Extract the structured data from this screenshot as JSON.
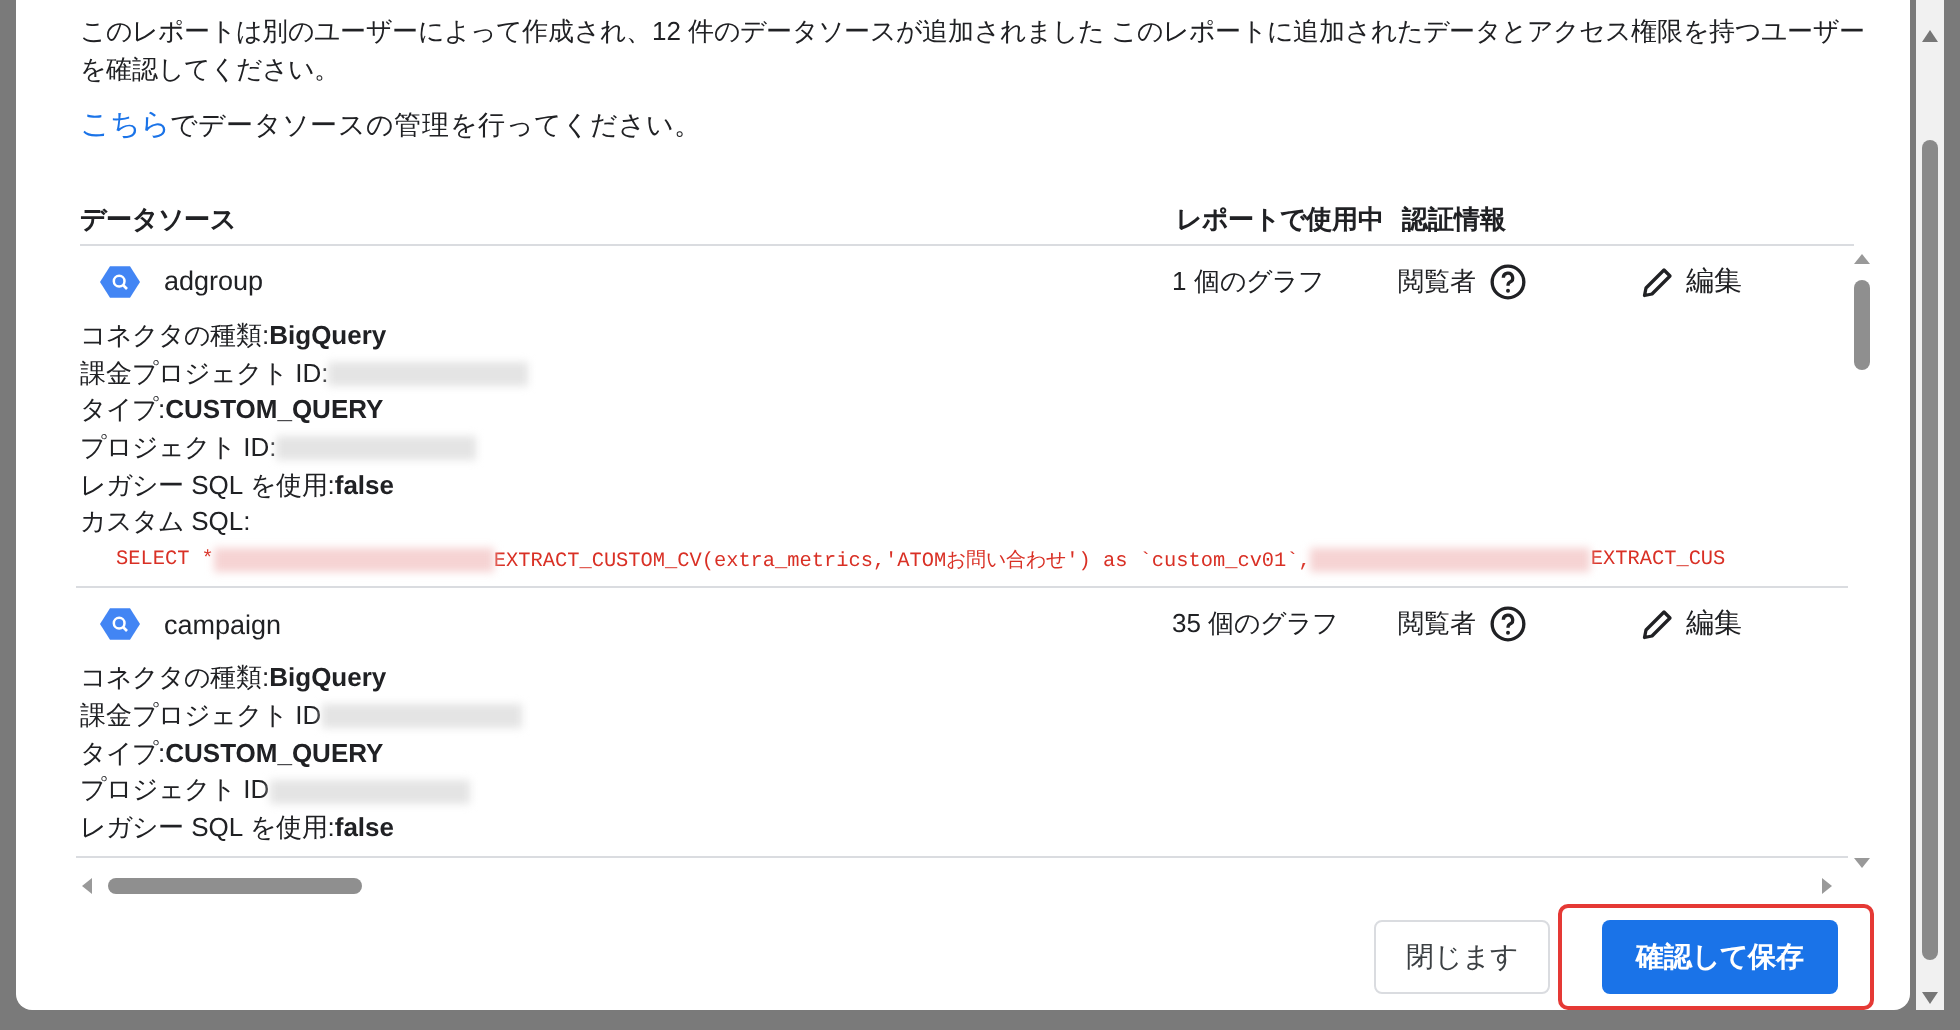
{
  "intro": "このレポートは別のユーザーによって作成され、12 件のデータソースが追加されました このレポートに追加されたデータとアクセス権限を持つユーザーを確認してください。",
  "manage": {
    "link": "こちら",
    "text": "でデータソースの管理を行ってください。"
  },
  "columns": [
    "データソース",
    "レポートで使用中",
    "認証情報"
  ],
  "rows": [
    {
      "name": "adgroup",
      "usage": "1 個のグラフ",
      "role": "閲覧者",
      "edit": "編集",
      "details": [
        {
          "label": "コネクタの種類: ",
          "value": "BigQuery"
        },
        {
          "label": "課金プロジェクト ID:",
          "redacted": true
        },
        {
          "label": "タイプ: ",
          "value": "CUSTOM_QUERY"
        },
        {
          "label": "プロジェクト ID:",
          "redacted": true
        },
        {
          "label": "レガシー SQL を使用: ",
          "value": "false"
        },
        {
          "label": "カスタム SQL:"
        }
      ],
      "sql": [
        {
          "kind": "text",
          "text": "SELECT *"
        },
        {
          "kind": "redacted"
        },
        {
          "kind": "text",
          "text": "EXTRACT_CUSTOM_CV(extra_metrics,'ATOMお問い合わせ') as `custom_cv01`,"
        },
        {
          "kind": "redacted"
        },
        {
          "kind": "text",
          "text": "EXTRACT_CUS"
        }
      ]
    },
    {
      "name": "campaign",
      "usage": "35 個のグラフ",
      "role": "閲覧者",
      "edit": "編集",
      "details": [
        {
          "label": "コネクタの種類: ",
          "value": "BigQuery"
        },
        {
          "label": "課金プロジェクト ID",
          "redacted": true
        },
        {
          "label": "タイプ: ",
          "value": "CUSTOM_QUERY"
        },
        {
          "label": "プロジェクト ID",
          "redacted": true
        },
        {
          "label": "レガシー SQL を使用: ",
          "value": "false"
        }
      ]
    }
  ],
  "buttons": [
    {
      "label": "閉じます",
      "kind": "secondary",
      "highlighted": false
    },
    {
      "label": "確認して保存",
      "kind": "primary",
      "highlighted": true
    }
  ]
}
